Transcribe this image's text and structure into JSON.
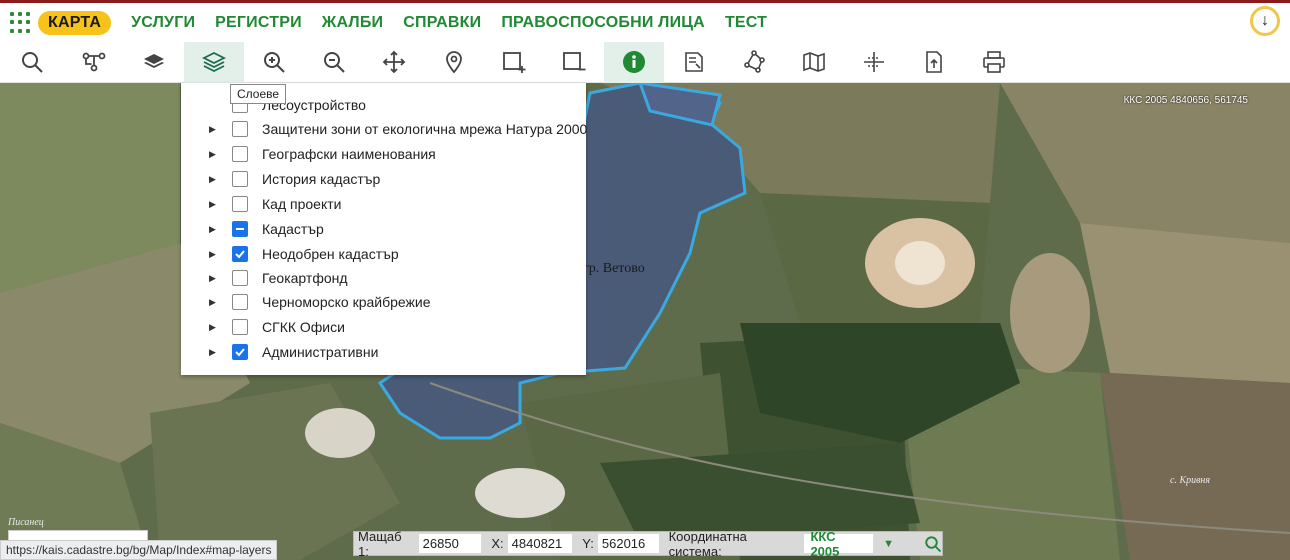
{
  "nav": {
    "items": [
      {
        "label": "КАРТА",
        "active": true
      },
      {
        "label": "УСЛУГИ"
      },
      {
        "label": "РЕГИСТРИ"
      },
      {
        "label": "ЖАЛБИ"
      },
      {
        "label": "СПРАВКИ"
      },
      {
        "label": "ПРАВОСПОСОБНИ ЛИЦА"
      },
      {
        "label": "ТЕСТ"
      }
    ],
    "download_icon": "arrow-down-icon"
  },
  "toolbar": {
    "tools": [
      "search-icon",
      "route-icon",
      "basemap-icon",
      "layers-icon",
      "zoom-in-icon",
      "zoom-out-icon",
      "pan-icon",
      "location-pin-icon",
      "add-rectangle-icon",
      "remove-rectangle-icon",
      "info-icon",
      "edit-document-icon",
      "polygon-icon",
      "map-icon",
      "crosshair-icon",
      "upload-document-icon",
      "print-icon"
    ],
    "active": [
      "layers-icon",
      "info-icon"
    ]
  },
  "tooltip": {
    "text": "Слоеве"
  },
  "layers": [
    {
      "label": "Лесоустройство",
      "state": "unchecked",
      "has_arrow": false
    },
    {
      "label": "Защитени зони от екологична мрежа Натура 2000",
      "state": "unchecked",
      "has_arrow": true
    },
    {
      "label": "Географски наименования",
      "state": "unchecked",
      "has_arrow": true
    },
    {
      "label": "История кадастър",
      "state": "unchecked",
      "has_arrow": true
    },
    {
      "label": "Кад проекти",
      "state": "unchecked",
      "has_arrow": true
    },
    {
      "label": "Кадастър",
      "state": "indeterminate",
      "has_arrow": true
    },
    {
      "label": "Неодобрен кадастър",
      "state": "checked",
      "has_arrow": true
    },
    {
      "label": "Геокартфонд",
      "state": "unchecked",
      "has_arrow": true
    },
    {
      "label": "Черноморско крайбрежие",
      "state": "unchecked",
      "has_arrow": true
    },
    {
      "label": "СГКК Офиси",
      "state": "unchecked",
      "has_arrow": true
    },
    {
      "label": "Административни",
      "state": "checked",
      "has_arrow": true
    }
  ],
  "map": {
    "coords_readout": "ККС 2005 4840656, 561745",
    "town_label": "гр. Ветово",
    "village_label": "с. Кривня",
    "village_label2": "Писанец"
  },
  "status": {
    "url": "https://kais.cadastre.bg/bg/Map/Index#map-layers"
  },
  "scalebar": {
    "scale_label": "Мащаб 1:",
    "scale_value": "26850",
    "x_label": "X:",
    "x_value": "4840821",
    "y_label": "Y:",
    "y_value": "562016",
    "system_label": "Координатна система:",
    "system_value": "ККС 2005"
  },
  "colors": {
    "accent": "#1f8a33",
    "active_nav": "#f7c31a",
    "boundary": "#3aa9e0"
  }
}
